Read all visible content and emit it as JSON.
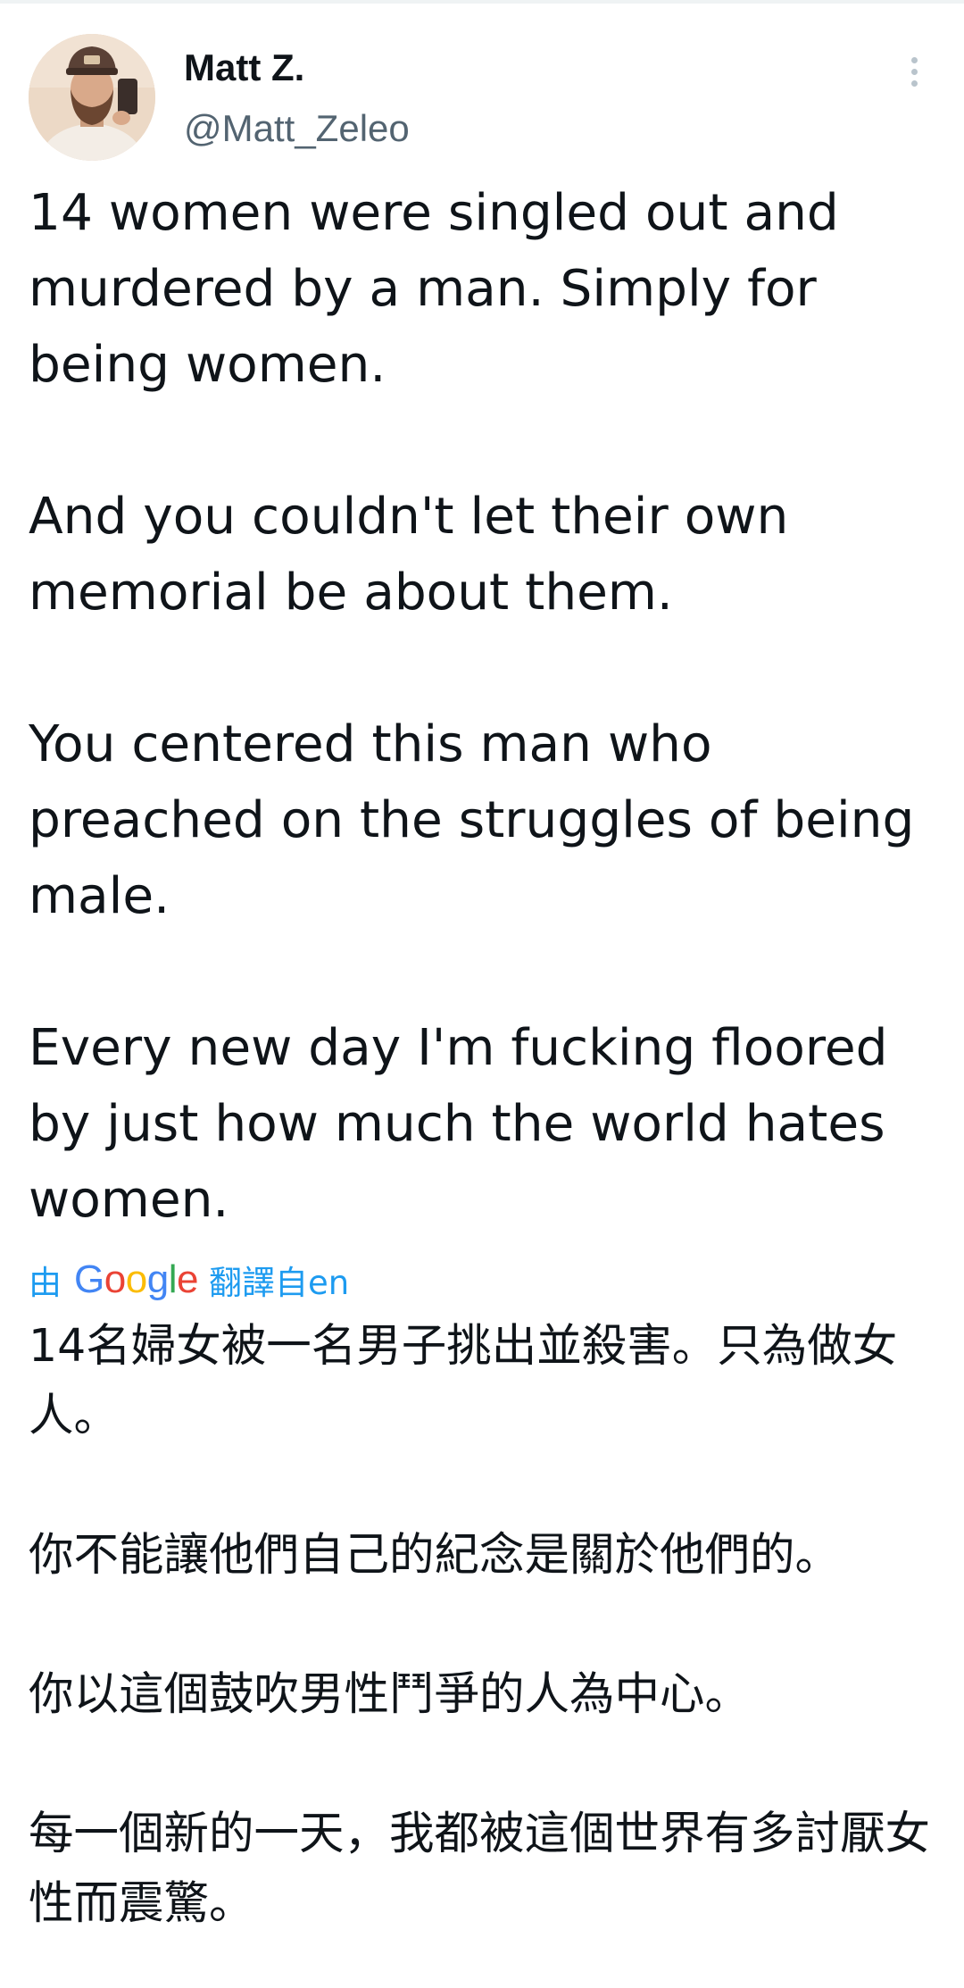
{
  "tweet": {
    "author": {
      "display_name": "Matt Z.",
      "handle": "@Matt_Zeleo"
    },
    "more_icon": "more-vertical-icon",
    "paragraphs": [
      "14 women were singled out and murdered by a man. Simply for being women.",
      "And you couldn't let their own memorial be about them.",
      "You centered this man who preached on the struggles of being male.",
      "Every new day I'm fucking floored by just how much the world hates women."
    ],
    "translation": {
      "prefix": "由",
      "provider_logo": "Google",
      "suffix": "翻譯自en",
      "paragraphs": [
        "14名婦女被一名男子挑出並殺害。只為做女人。",
        "你不能讓他們自己的紀念是關於他們的。",
        "你以這個鼓吹男性鬥爭的人為中心。",
        "每一個新的一天，我都被這個世界有多討厭女性而震驚。"
      ]
    },
    "colors": {
      "text": "#0f1419",
      "secondary": "#536471",
      "link": "#1d9bf0"
    }
  }
}
